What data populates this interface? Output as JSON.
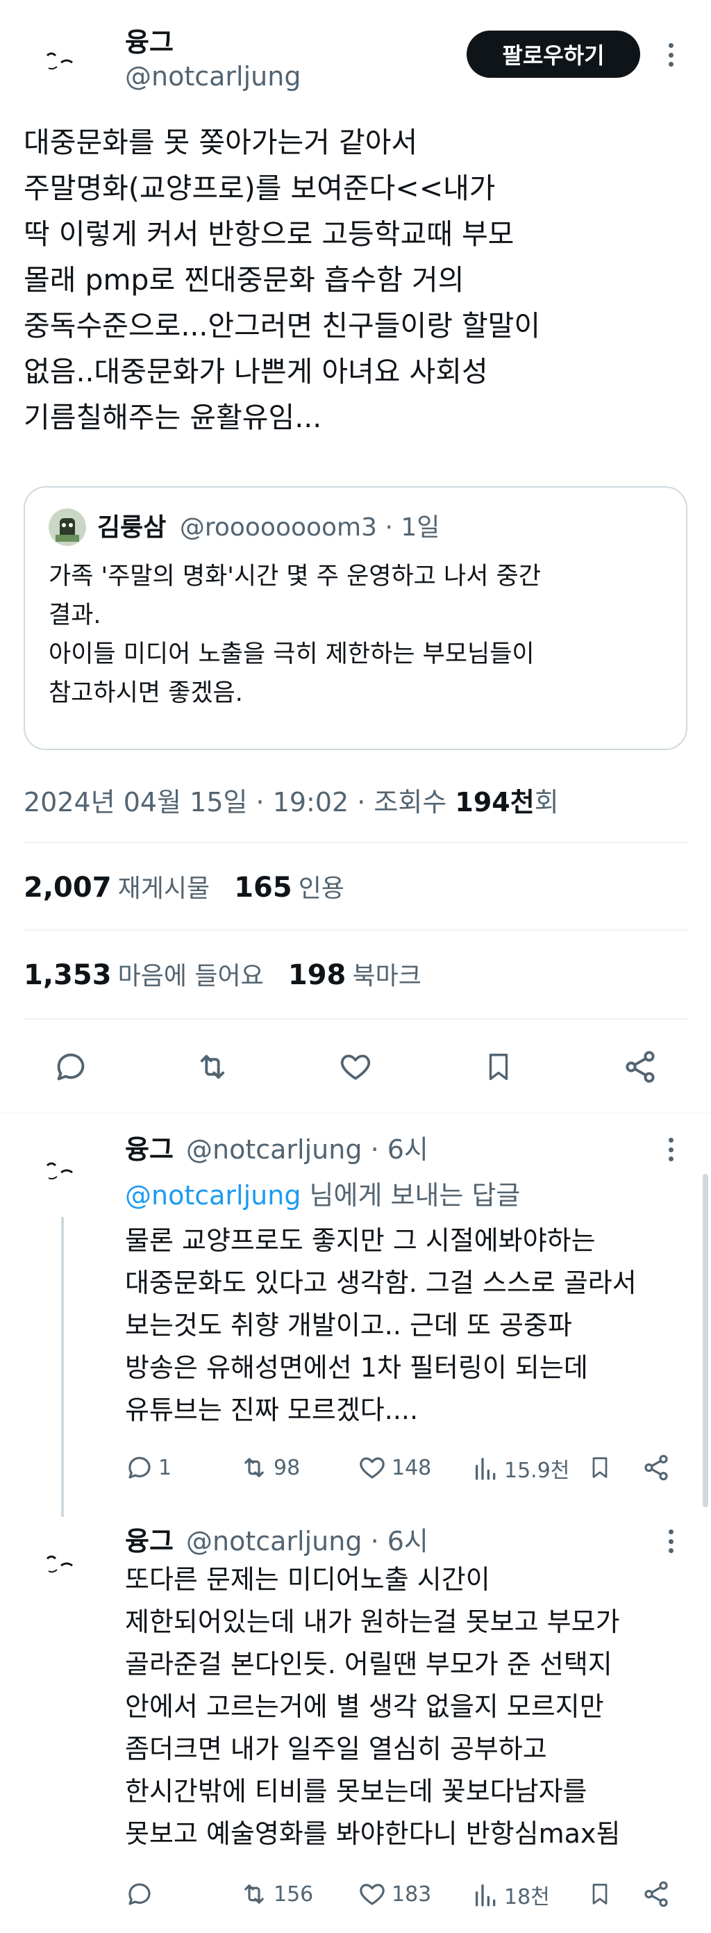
{
  "tweet": {
    "author_name": "융그",
    "author_handle": "@notcarljung",
    "follow_label": "팔로우하기",
    "text": "대중문화를 못 쫒아가는거 같아서\n주말명화(교양프로)를 보여준다<<내가\n딱 이렇게 커서 반항으로 고등학교때 부모\n몰래 pmp로 찐대중문화 흡수함 거의\n중독수준으로...안그러면 친구들이랑 할말이\n없음..대중문화가 나쁜게 아녀요 사회성\n기름칠해주는 윤활유임...",
    "quote": {
      "author_name": "김룽삼",
      "author_handle": "@roooooooom3",
      "time": "· 1일",
      "text": "가족 '주말의 명화'시간 몇 주 운영하고 나서 중간\n결과.\n아이들 미디어 노출을 극히 제한하는 부모님들이\n참고하시면 좋겠음."
    },
    "meta_date": "2024년 04월 15일 · 19:02 · 조회수",
    "meta_views": "194천",
    "meta_views_suffix": "회",
    "stats": {
      "retweets": "2,007",
      "retweets_label": "재게시물",
      "quotes": "165",
      "quotes_label": "인용",
      "likes": "1,353",
      "likes_label": "마음에 들어요",
      "bookmarks": "198",
      "bookmarks_label": "북마크"
    },
    "actions": [
      "reply-icon",
      "retweet-icon",
      "like-icon",
      "bookmark-icon",
      "share-icon"
    ]
  },
  "replies": [
    {
      "author_name": "융그",
      "author_handle": "@notcarljung",
      "time": "· 6시",
      "replying_to_handle": "@notcarljung",
      "replying_to_suffix": " 님에게 보내는 답글",
      "text": "물론 교양프로도 좋지만 그 시절에봐야하는\n대중문화도 있다고 생각함. 그걸 스스로 골라서\n보는것도 취향 개발이고.. 근데 또 공중파\n방송은 유해성면에선 1차 필터링이 되는데\n유튜브는 진짜 모르겠다....",
      "replies": "1",
      "retweets": "98",
      "likes": "148",
      "views": "15.9천"
    },
    {
      "author_name": "융그",
      "author_handle": "@notcarljung",
      "time": "· 6시",
      "text": "또다른 문제는 미디어노출 시간이\n제한되어있는데 내가 원하는걸 못보고 부모가\n골라준걸 본다인듯. 어릴땐 부모가 준 선택지\n안에서 고르는거에 별 생각 없을지 모르지만\n좀더크면 내가 일주일 열심히 공부하고\n한시간밖에 티비를 못보는데 꽃보다남자를\n못보고 예술영화를 봐야한다니 반항심max됨",
      "replies": "",
      "retweets": "156",
      "likes": "183",
      "views": "18천"
    }
  ],
  "colors": {
    "text": "#0f1419",
    "secondary": "#536471",
    "accent": "#1d9bf0",
    "border": "#cfd9de"
  }
}
